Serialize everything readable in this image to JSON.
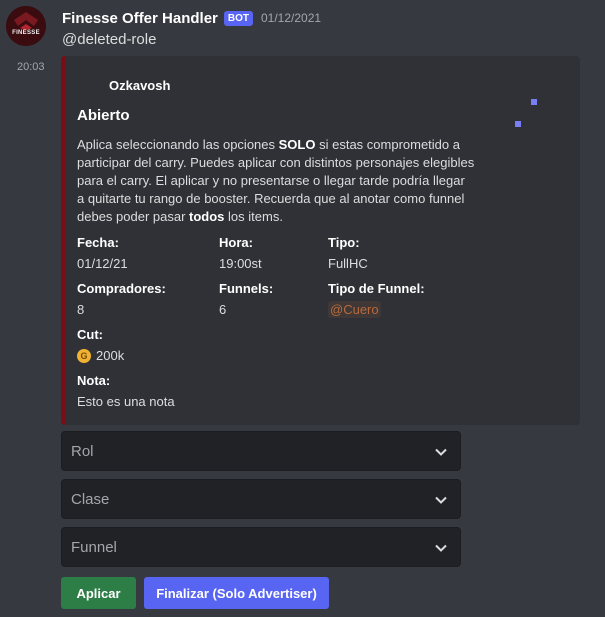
{
  "message": {
    "author": "Finesse Offer Handler",
    "bot_tag": "BOT",
    "date": "01/12/2021",
    "mention": "@deleted-role",
    "time": "20:03",
    "avatar_text": "FINESSE"
  },
  "embed": {
    "accent_color": "#7a0d16",
    "author_name": "Ozkavosh",
    "title": "Abierto",
    "description": {
      "p1": "Aplica seleccionando las opciones ",
      "b1": "SOLO",
      "p2": " si estas comprometido a participar del carry. Puedes aplicar con distintos personajes elegibles para el carry. El aplicar y no presentarse o llegar tarde podría llegar a quitarte tu rango de booster. Recuerda que al anotar como funnel debes poder pasar ",
      "b2": "todos",
      "p3": " los items."
    },
    "fields": {
      "fecha": {
        "name": "Fecha:",
        "value": "01/12/21"
      },
      "hora": {
        "name": "Hora:",
        "value": "19:00st"
      },
      "tipo": {
        "name": "Tipo:",
        "value": "FullHC"
      },
      "compradores": {
        "name": "Compradores:",
        "value": "8"
      },
      "funnels": {
        "name": "Funnels:",
        "value": "6"
      },
      "tipo_funnel": {
        "name": "Tipo de Funnel:",
        "value": "@Cuero"
      },
      "cut": {
        "name": "Cut:",
        "value": "200k",
        "icon": "gold-coin-icon",
        "icon_letter": "G"
      },
      "nota": {
        "name": "Nota:",
        "value": "Esto es una nota"
      }
    }
  },
  "selects": [
    {
      "placeholder": "Rol"
    },
    {
      "placeholder": "Clase"
    },
    {
      "placeholder": "Funnel"
    }
  ],
  "buttons": {
    "apply": "Aplicar",
    "finish": "Finalizar (Solo Advertiser)"
  },
  "colors": {
    "background": "#36393f",
    "embed_bg": "#2f3136",
    "select_bg": "#202225",
    "bot_tag": "#5865f2",
    "success_button": "#2d7d46",
    "primary_button": "#5865f2",
    "role_mention": "#b86a3c"
  }
}
